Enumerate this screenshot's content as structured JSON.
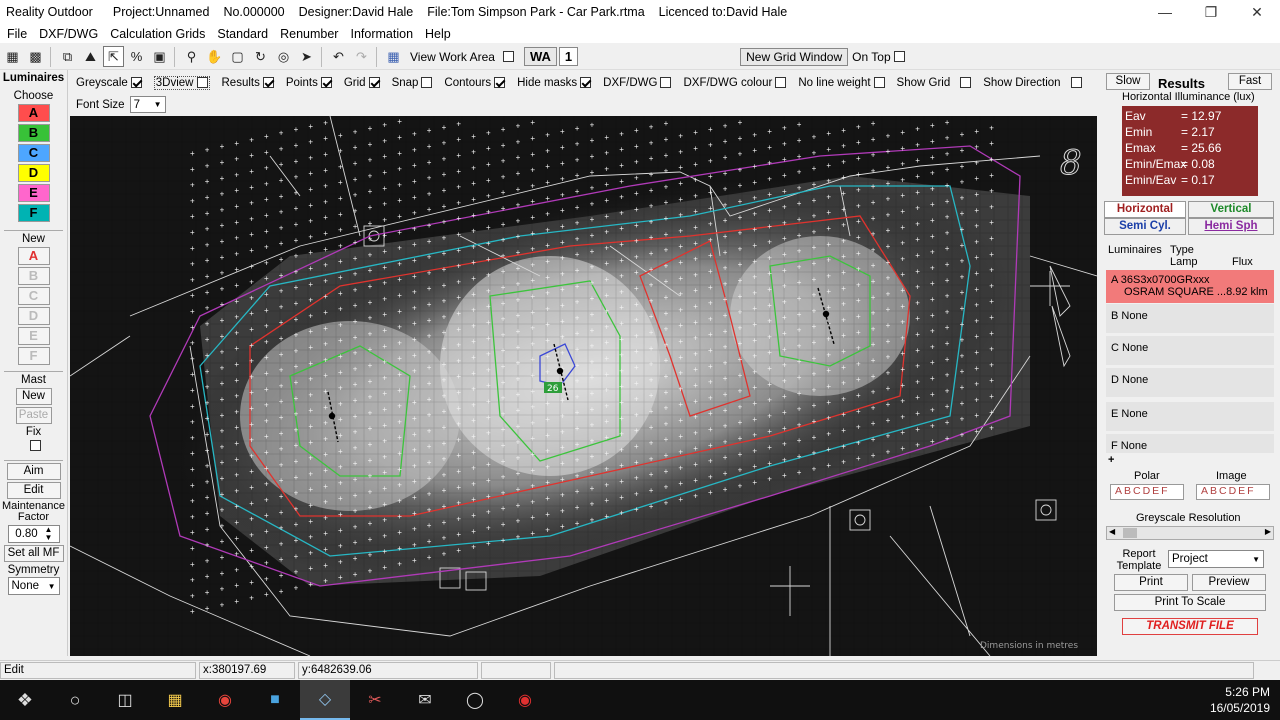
{
  "window": {
    "app": "Reality Outdoor",
    "project": "Project:Unnamed",
    "number": "No.000000",
    "designer": "Designer:David Hale",
    "file": "File:Tom Simpson Park - Car Park.rtma",
    "licence": "Licenced to:David Hale"
  },
  "menu": [
    "File",
    "DXF/DWG",
    "Calculation Grids",
    "Standard",
    "Renumber",
    "Information",
    "Help"
  ],
  "toolbar": {
    "view_work_area": "View Work Area",
    "wa_label": "WA",
    "wa_number": "1",
    "new_grid_window": "New Grid Window",
    "on_top": "On Top"
  },
  "options": {
    "greyscale": "Greyscale",
    "threed": "3Dview",
    "results": "Results",
    "points": "Points",
    "grid": "Grid",
    "snap": "Snap",
    "contours": "Contours",
    "hide_masks": "Hide masks",
    "dxf": "DXF/DWG",
    "dxf_colour": "DXF/DWG colour",
    "no_line_weight": "No line weight",
    "show_grid": "Show Grid",
    "show_direction": "Show Direction",
    "font_size_label": "Font Size",
    "font_size_value": "7"
  },
  "left": {
    "luminaires": "Luminaires",
    "choose": "Choose",
    "letters": [
      "A",
      "B",
      "C",
      "D",
      "E",
      "F"
    ],
    "colors": [
      "#ff4d4d",
      "#38c238",
      "#4da6ff",
      "#ffff00",
      "#ff66cc",
      "#00b3b3"
    ],
    "new": "New",
    "new_letters": [
      "A",
      "B",
      "C",
      "D",
      "E",
      "F"
    ],
    "mast": "Mast",
    "mast_new": "New",
    "paste": "Paste",
    "fix": "Fix",
    "aim": "Aim",
    "edit": "Edit",
    "maintenance": "Maintenance Factor",
    "mf_value": "0.80",
    "set_all_mf": "Set all MF",
    "symmetry": "Symmetry",
    "symmetry_value": "None"
  },
  "right": {
    "slow": "Slow",
    "results_title": "Results",
    "fast": "Fast",
    "subtitle": "Horizontal Illuminance (lux)",
    "stats": [
      {
        "k": "Eav",
        "v": "= 12.97"
      },
      {
        "k": "Emin",
        "v": "= 2.17"
      },
      {
        "k": "Emax",
        "v": "= 25.66"
      },
      {
        "k": "Emin/Emax",
        "v": "= 0.08"
      },
      {
        "k": "Emin/Eav",
        "v": "= 0.17"
      }
    ],
    "tab_horizontal": "Horizontal",
    "tab_vertical": "Vertical",
    "tab_semicyl": "Semi Cyl.",
    "tab_hemisph": "Hemi Sph",
    "col_luminaires": "Luminaires",
    "col_type": "Type",
    "col_lamp": "Lamp",
    "col_flux": "Flux",
    "lum_a_code": "A  36S3x0700GRxxx",
    "lum_a_desc": "OSRAM SQUARE ...8.92 klm",
    "lum_rows": [
      "B  None",
      "C  None",
      "D  None",
      "E  None",
      "F  None"
    ],
    "polar": "Polar",
    "image": "Image",
    "abcdef": "ABCDEF",
    "greyscale_res": "Greyscale Resolution",
    "report_template": "Report Template",
    "project": "Project",
    "print": "Print",
    "preview": "Preview",
    "print_to_scale": "Print To Scale",
    "transmit": "TRANSMIT FILE"
  },
  "status": {
    "mode": "Edit",
    "x": "x:380197.69",
    "y": "y:6482639.06"
  },
  "canvas": {
    "marker_label": "8",
    "selected_value": "26",
    "dimension_note": "Dimensions in metres"
  },
  "taskbar": {
    "time": "5:26 PM",
    "date": "16/05/2019"
  }
}
